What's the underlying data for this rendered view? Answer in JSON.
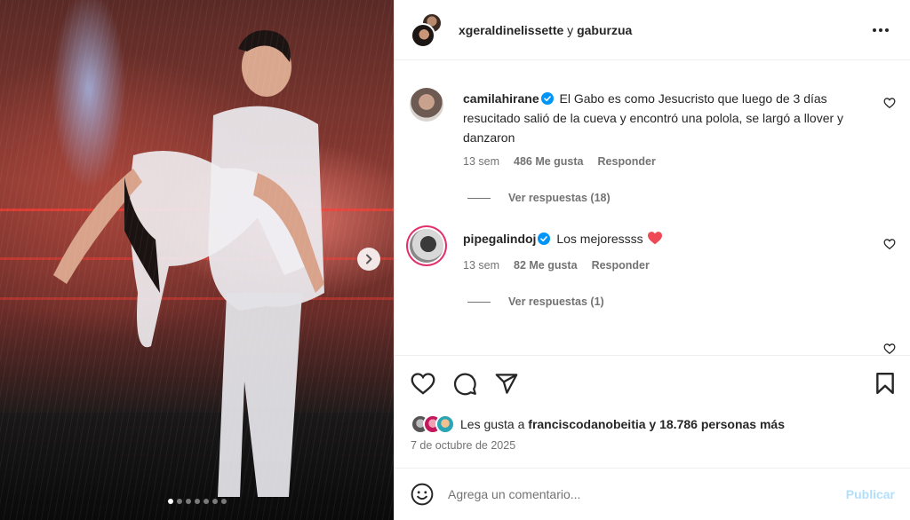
{
  "header": {
    "user_primary": "xgeraldinelissette",
    "connector": " y ",
    "user_secondary": "gaburzua"
  },
  "comments": [
    {
      "username": "camilahirane",
      "verified": true,
      "text": "El Gabo es como Jesucristo que luego de 3 días resucitado salió de la cueva y encontró una polola, se largó a llover y danzaron",
      "time": "13 sem",
      "likes": "486 Me gusta",
      "reply_label": "Responder",
      "view_replies": "Ver respuestas (18)"
    },
    {
      "username": "pipegalindoj",
      "verified": true,
      "text": "Los mejoressss ",
      "emoji": "heart-emoji",
      "time": "13 sem",
      "likes": "82 Me gusta",
      "reply_label": "Responder",
      "view_replies": "Ver respuestas (1)"
    }
  ],
  "likes": {
    "prefix": "Les gusta a ",
    "user": "franciscodanobeitia",
    "suffix": " y 18.786 personas más"
  },
  "date": "7 de octubre de 2025",
  "composer": {
    "placeholder": "Agrega un comentario...",
    "publish_label": "Publicar"
  },
  "carousel": {
    "total_slides": 7,
    "active_index": 0
  },
  "colors": {
    "verified": "#0095f6",
    "publish_disabled": "#b2dffc",
    "secondary_text": "#737373",
    "heart_emoji": "#ed4956"
  },
  "icons": [
    "more-options-icon",
    "heart-icon",
    "comment-icon",
    "share-icon",
    "save-icon",
    "emoji-icon",
    "chevron-right-icon",
    "verified-badge-icon"
  ]
}
